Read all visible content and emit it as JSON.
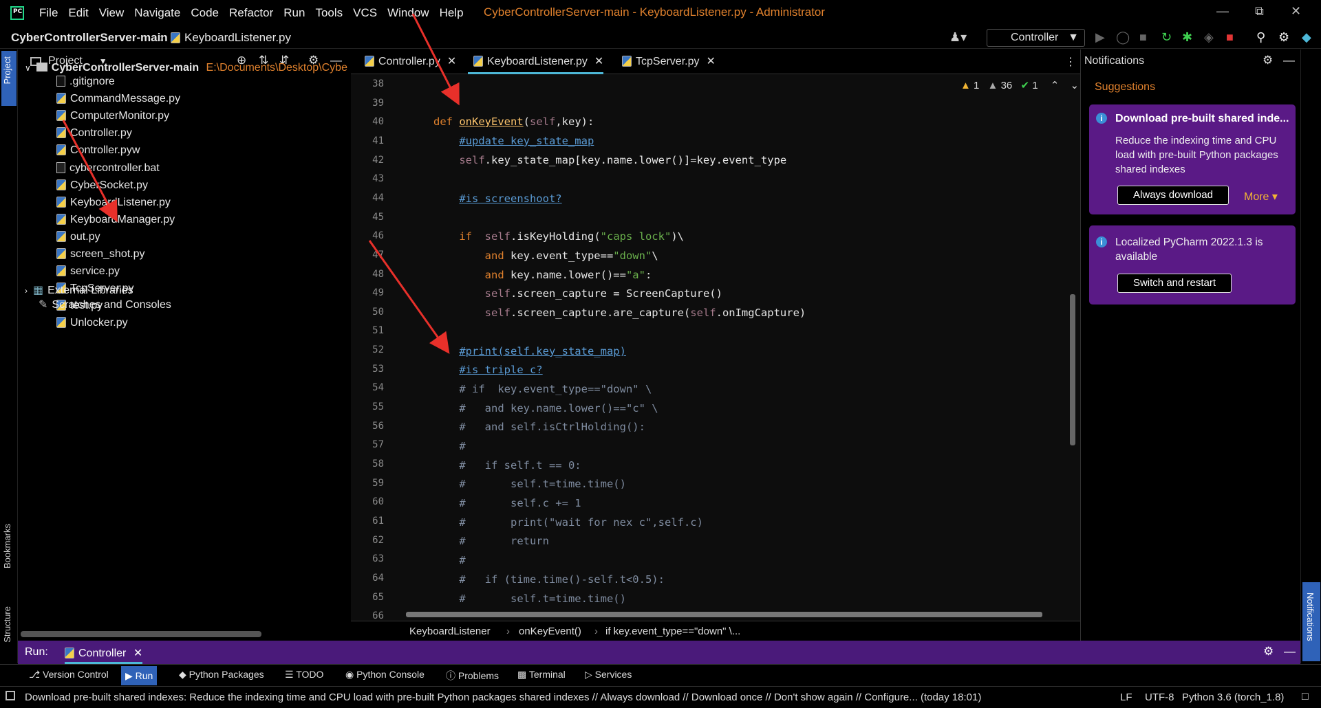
{
  "window": {
    "title": "CyberControllerServer-main - KeyboardListener.py - Administrator",
    "menu": [
      "File",
      "Edit",
      "View",
      "Navigate",
      "Code",
      "Refactor",
      "Run",
      "Tools",
      "VCS",
      "Window",
      "Help"
    ]
  },
  "navbar": {
    "project": "CyberControllerServer-main",
    "file": "KeyboardListener.py",
    "run_config": "Controller"
  },
  "project_panel": {
    "title": "Project",
    "root_name": "CyberControllerServer-main",
    "root_path": "E:\\Documents\\Desktop\\Cybe",
    "files": [
      ".gitignore",
      "CommandMessage.py",
      "ComputerMonitor.py",
      "Controller.py",
      "Controller.pyw",
      "cybercontroller.bat",
      "CyberSocket.py",
      "KeyboardListener.py",
      "KeyboardManager.py",
      "out.py",
      "screen_shot.py",
      "service.py",
      "TcpServer.py",
      "test.py",
      "Unlocker.py"
    ],
    "external": "External Libraries",
    "scratches": "Scratches and Consoles"
  },
  "editor": {
    "tabs": [
      "Controller.py",
      "KeyboardListener.py",
      "TcpServer.py"
    ],
    "inspections": {
      "warnings": "1",
      "weak": "36",
      "ok": "1"
    },
    "line_numbers": [
      "38",
      "39",
      "40",
      "41",
      "42",
      "43",
      "44",
      "45",
      "46",
      "47",
      "48",
      "49",
      "50",
      "51",
      "52",
      "53",
      "54",
      "55",
      "56",
      "57",
      "58",
      "59",
      "60",
      "61",
      "62",
      "63",
      "64",
      "65",
      "66"
    ],
    "breadcrumbs": [
      "KeyboardListener",
      "onKeyEvent()",
      "if key.event_type==\"down\" \\..."
    ]
  },
  "notifications": {
    "title": "Notifications",
    "section": "Suggestions",
    "card1": {
      "title": "Download pre-built shared inde...",
      "text": "Reduce the indexing time and CPU load with pre-built Python packages shared indexes",
      "button": "Always download",
      "more": "More"
    },
    "card2": {
      "title": "Localized PyCharm 2022.1.3 is available",
      "button": "Switch and restart"
    }
  },
  "run_bar": {
    "label": "Run:",
    "tab": "Controller"
  },
  "tool_buttons": [
    "Version Control",
    "Run",
    "Python Packages",
    "TODO",
    "Python Console",
    "Problems",
    "Terminal",
    "Services"
  ],
  "status": {
    "message": "Download pre-built shared indexes: Reduce the indexing time and CPU load with pre-built Python packages shared indexes // Always download // Download once // Don't show again // Configure... (today 18:01)",
    "line_sep": "LF",
    "encoding": "UTF-8",
    "interpreter": "Python 3.6 (torch_1.8)"
  },
  "side_tabs": {
    "left_top": "Project",
    "bookmarks": "Bookmarks",
    "structure": "Structure",
    "right": "Notifications"
  },
  "colors": {
    "accent": "#4db8d8",
    "purple": "#5a1a86",
    "annotation_arrow": "#e8302a"
  }
}
